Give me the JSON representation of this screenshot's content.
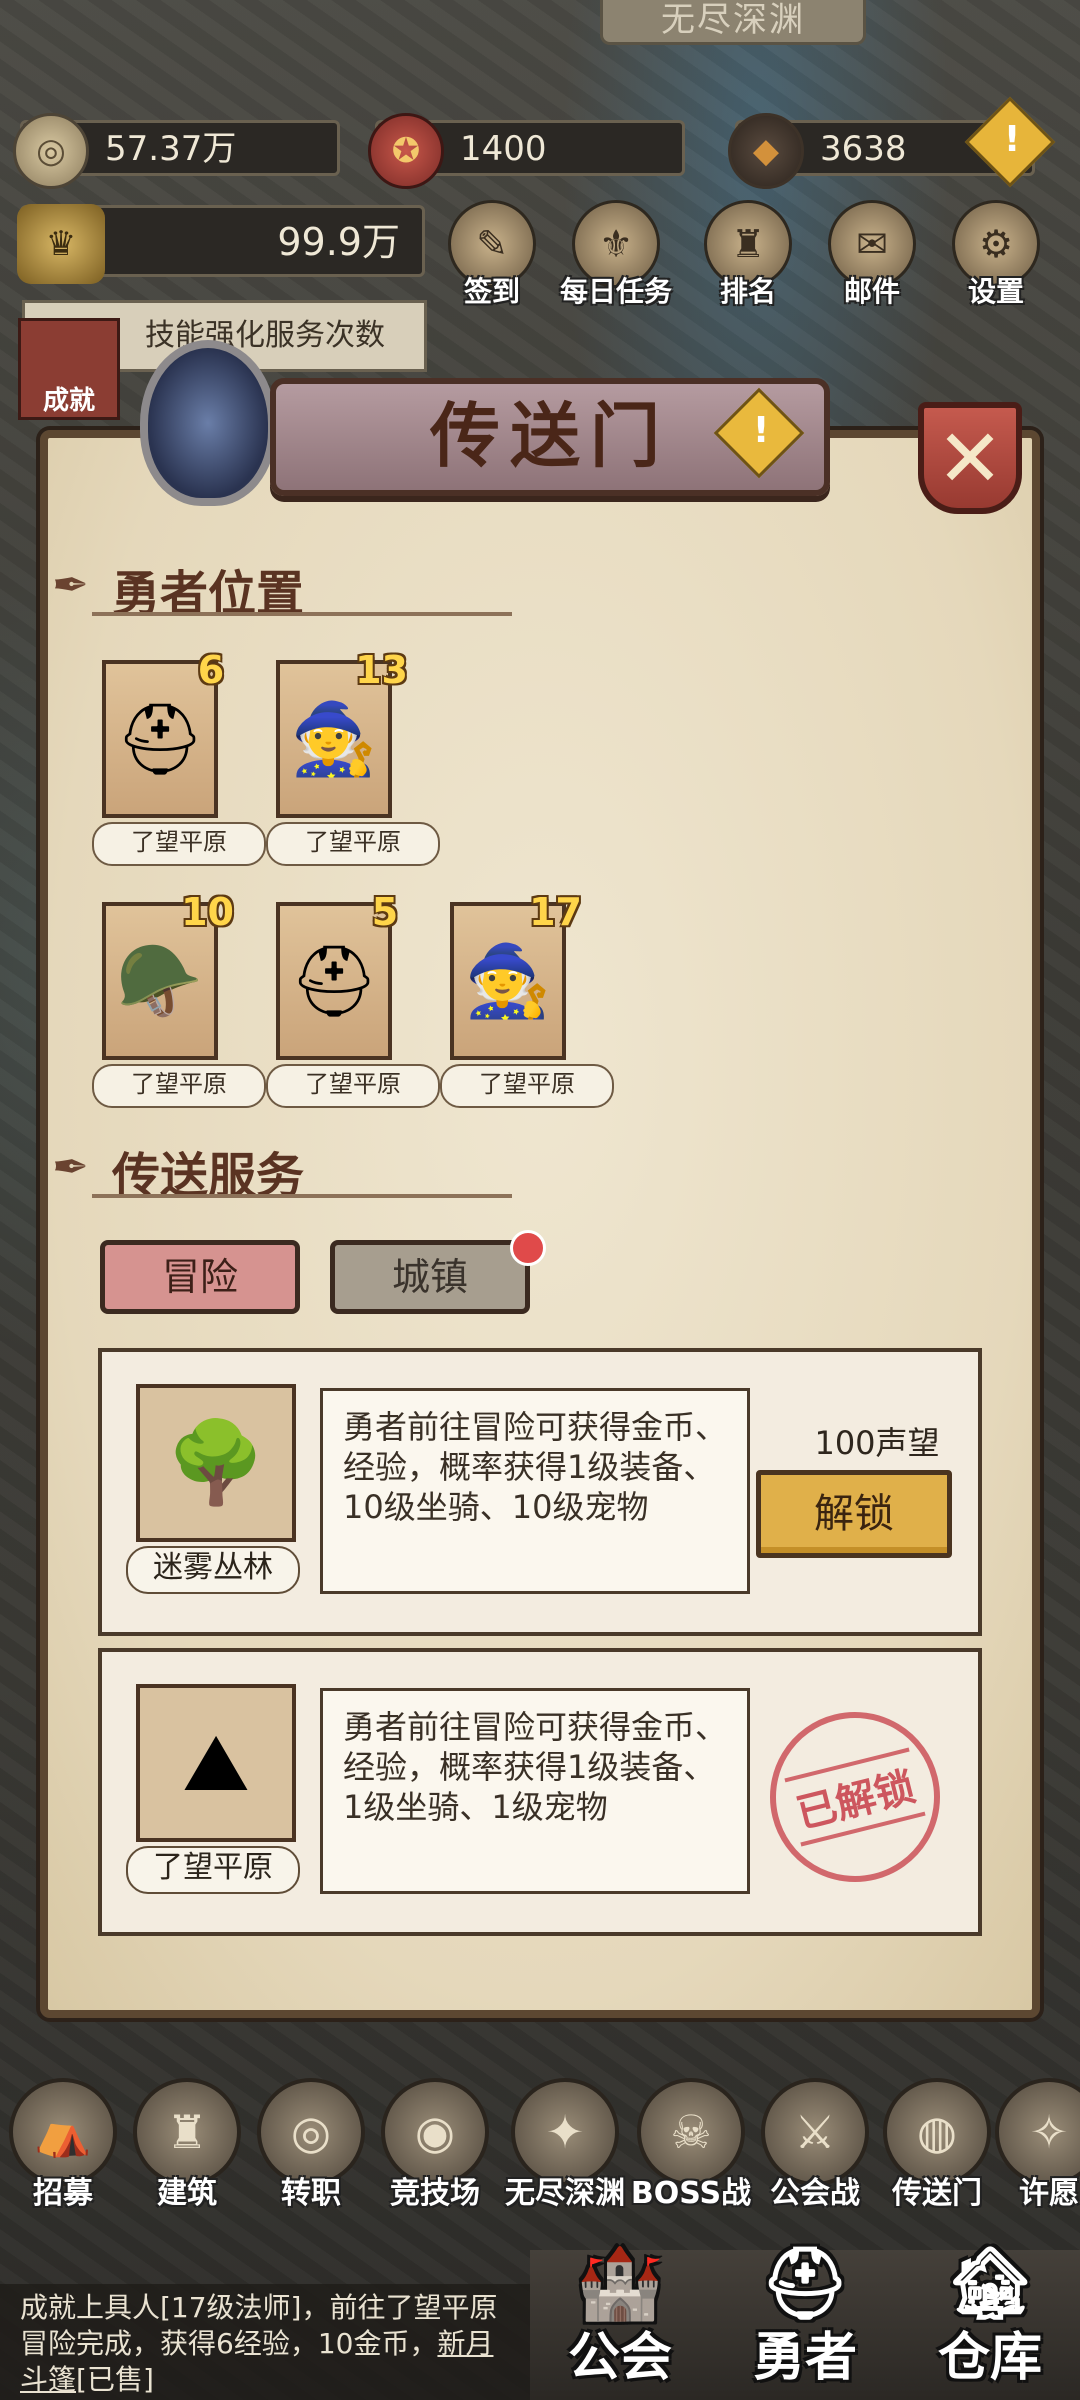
{
  "zone_title": "无尽深渊",
  "resources": {
    "gold": {
      "icon": "gold-coin-icon",
      "value": "57.37万"
    },
    "honor": {
      "icon": "crest-icon",
      "value": "1400"
    },
    "gem": {
      "icon": "dark-crystal-icon",
      "value": "3638"
    },
    "power": {
      "icon": "power-emblem-icon",
      "value": "99.9万"
    },
    "alert": "!"
  },
  "top_menu": [
    {
      "label": "签到",
      "icon": "scroll-icon"
    },
    {
      "label": "每日任务",
      "icon": "quest-icon"
    },
    {
      "label": "排名",
      "icon": "trophy-icon"
    },
    {
      "label": "邮件",
      "icon": "mail-icon"
    },
    {
      "label": "设置",
      "icon": "gear-icon"
    }
  ],
  "side_banner": {
    "text": "技能强化服务次数",
    "achievement": "成就"
  },
  "dialog": {
    "title": "传送门",
    "title_alert": "!",
    "close": "✕",
    "heroes_section": "勇者位置",
    "heroes": [
      {
        "level": "6",
        "location": "了望平原",
        "avatar": "knight"
      },
      {
        "level": "13",
        "location": "了望平原",
        "avatar": "witch"
      },
      {
        "level": "10",
        "location": "了望平原",
        "avatar": "viking"
      },
      {
        "level": "5",
        "location": "了望平原",
        "avatar": "warrior"
      },
      {
        "level": "17",
        "location": "了望平原",
        "avatar": "witch"
      }
    ],
    "service_section": "传送服务",
    "tabs": {
      "adventure": "冒险",
      "town": "城镇"
    },
    "services": [
      {
        "name": "迷雾丛林",
        "description": "勇者前往冒险可获得金币、经验，概率获得1级装备、10级坐骑、10级宠物",
        "cost": "100声望",
        "button": "解锁"
      },
      {
        "name": "了望平原",
        "description": "勇者前往冒险可获得金币、经验，概率获得1级装备、1级坐骑、1级宠物",
        "status": "已解锁"
      }
    ]
  },
  "bottom_nav": [
    {
      "label": "招募",
      "icon": "tent-icon"
    },
    {
      "label": "建筑",
      "icon": "castle-icon"
    },
    {
      "label": "转职",
      "icon": "swirl-icon"
    },
    {
      "label": "竞技场",
      "icon": "target-icon"
    },
    {
      "label": "无尽深渊",
      "icon": "abyss-icon"
    },
    {
      "label": "BOSS战",
      "icon": "skull-helmet-icon"
    },
    {
      "label": "公会战",
      "icon": "crossed-swords-icon"
    },
    {
      "label": "传送门",
      "icon": "portal-icon"
    },
    {
      "label": "许愿",
      "icon": "wish-icon"
    }
  ],
  "news": {
    "text": "成就上具人[17级法师]，前往了望平原冒险完成，获得6经验，10金币，",
    "link": "新月斗篷",
    "suffix": "[已售]"
  },
  "main_tabs": {
    "guild": "公会",
    "heroes": "勇者",
    "storage": "仓库"
  }
}
